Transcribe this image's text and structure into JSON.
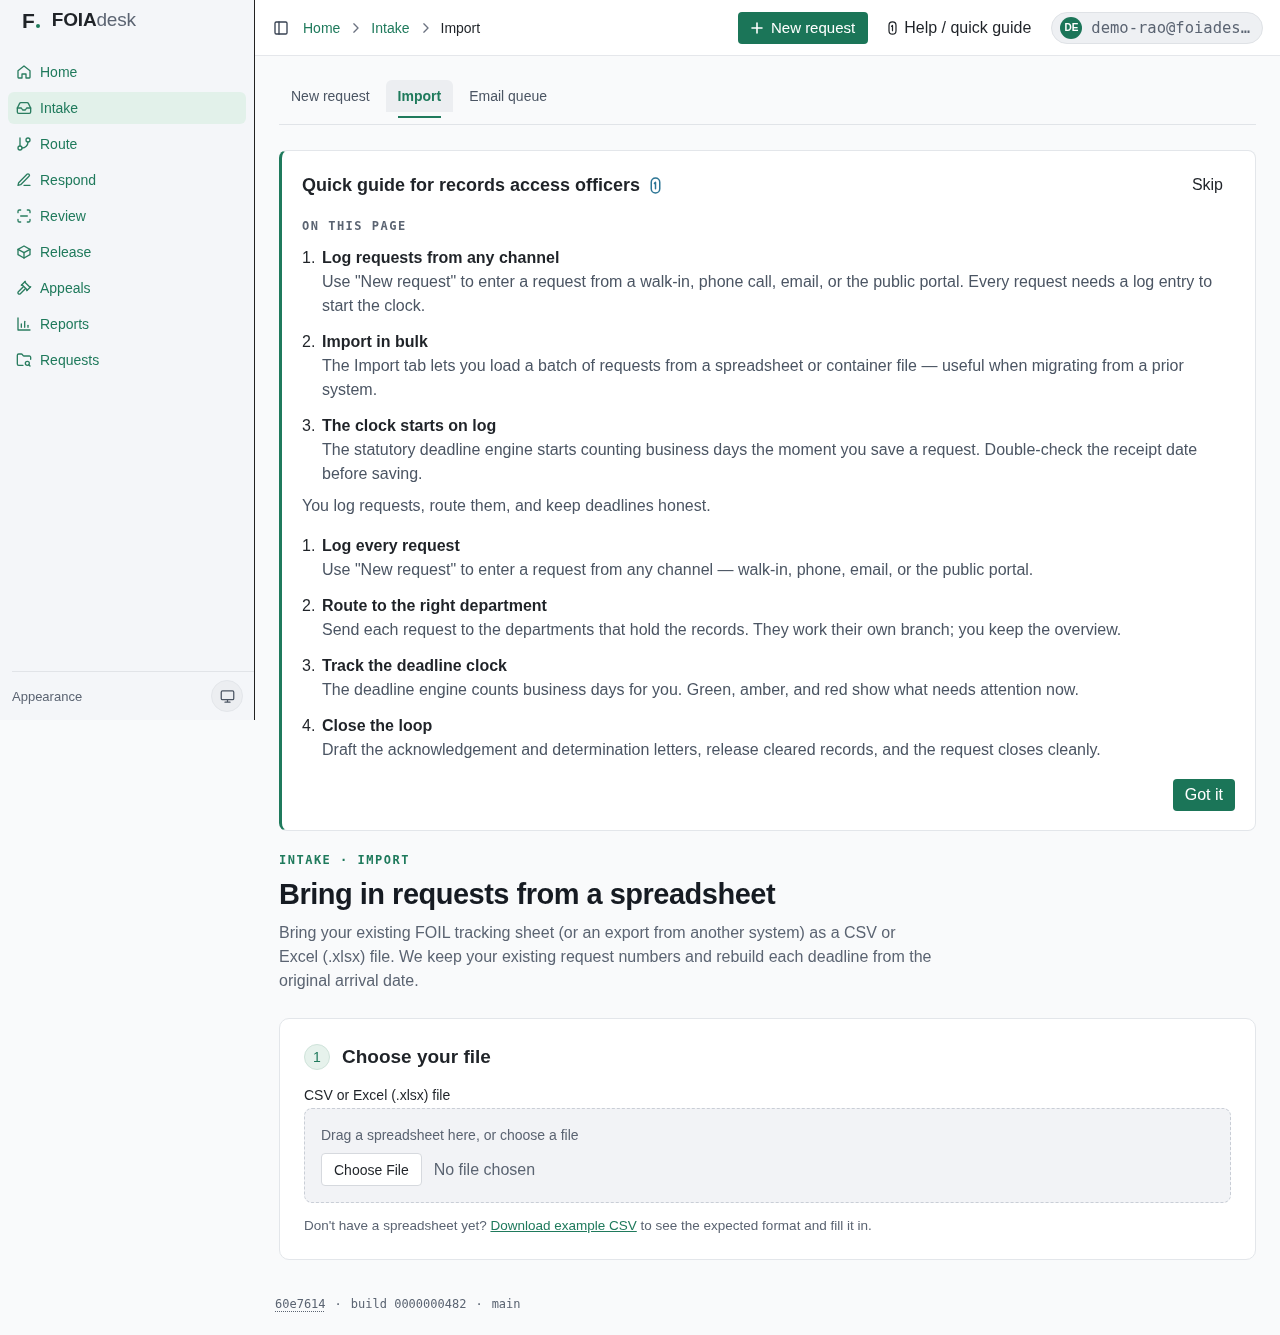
{
  "sidebar": {
    "logo": {
      "letter": "F",
      "bold": "FOIA",
      "light": "desk"
    },
    "items": [
      {
        "label": "Home",
        "selected": false
      },
      {
        "label": "Intake",
        "selected": true
      },
      {
        "label": "Route",
        "selected": false
      },
      {
        "label": "Respond",
        "selected": false
      },
      {
        "label": "Review",
        "selected": false
      },
      {
        "label": "Release",
        "selected": false
      },
      {
        "label": "Appeals",
        "selected": false
      },
      {
        "label": "Reports",
        "selected": false
      },
      {
        "label": "Requests",
        "selected": false
      }
    ],
    "footer": {
      "label": "Appearance"
    }
  },
  "topbar": {
    "breadcrumb": [
      {
        "label": "Home",
        "current": false
      },
      {
        "label": "Intake",
        "current": false
      },
      {
        "label": "Import",
        "current": true
      }
    ],
    "new_request": "New request",
    "help": "Help / quick guide",
    "user": {
      "initials": "DE",
      "email": "demo-rao@foiades…"
    }
  },
  "tabs": [
    {
      "label": "New request",
      "selected": false
    },
    {
      "label": "Import",
      "selected": true
    },
    {
      "label": "Email queue",
      "selected": false
    }
  ],
  "guide": {
    "title": "Quick guide for records access officers",
    "skip": "Skip",
    "section_label": "ON THIS PAGE",
    "steps": [
      {
        "marker": "1.",
        "title": "Log requests from any channel",
        "text": "Use \"New request\" to enter a request from a walk-in, phone call, email, or the public portal. Every request needs a log entry to start the clock."
      },
      {
        "marker": "2.",
        "title": "Import in bulk",
        "text": "The Import tab lets you load a batch of requests from a spreadsheet or container file — useful when migrating from a prior system."
      },
      {
        "marker": "3.",
        "title": "The clock starts on log",
        "text": "The statutory deadline engine starts counting business days the moment you save a request. Double-check the receipt date before saving."
      }
    ],
    "intro": "You log requests, route them, and keep deadlines honest.",
    "points": [
      {
        "marker": "1.",
        "title": "Log every request",
        "text": "Use \"New request\" to enter a request from any channel — walk-in, phone, email, or the public portal."
      },
      {
        "marker": "2.",
        "title": "Route to the right department",
        "text": "Send each request to the departments that hold the records. They work their own branch; you keep the overview."
      },
      {
        "marker": "3.",
        "title": "Track the deadline clock",
        "text": "The deadline engine counts business days for you. Green, amber, and red show what needs attention now."
      },
      {
        "marker": "4.",
        "title": "Close the loop",
        "text": "Draft the acknowledgement and determination letters, release cleared records, and the request closes cleanly."
      }
    ],
    "button": "Got it"
  },
  "header": {
    "eyebrow": "INTAKE · IMPORT",
    "title": "Bring in requests from a spreadsheet",
    "description": "Bring your existing FOIL tracking sheet (or an export from another system) as a CSV or Excel (.xlsx) file. We keep your existing request numbers and rebuild each deadline from the original arrival date."
  },
  "step_card": {
    "number": "1",
    "title": "Choose your file",
    "field_label": "CSV or Excel (.xlsx) file",
    "dropzone_hint": "Drag a spreadsheet here, or choose a file",
    "choose_button": "Choose File",
    "file_status": "No file chosen",
    "help_before": "Don't have a spreadsheet yet?",
    "help_link": "Download example CSV",
    "help_after": "to see the expected format and fill it in."
  },
  "build_footer": {
    "commit": "60e7614",
    "separator": "·",
    "build": "build 0000000482",
    "branch": "main"
  }
}
